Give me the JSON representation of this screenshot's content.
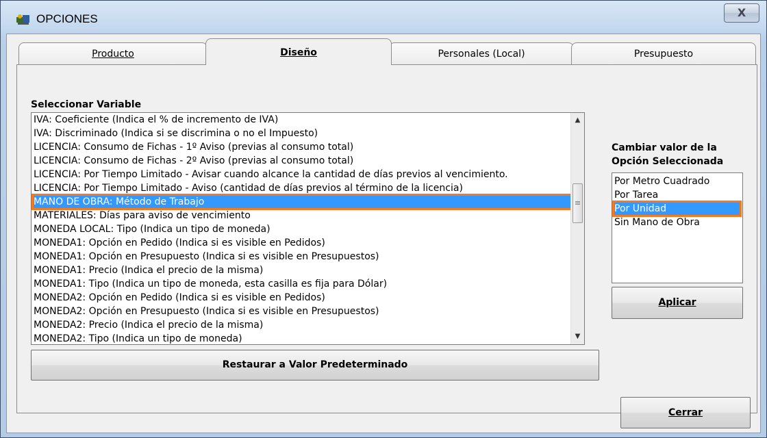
{
  "window": {
    "title": "OPCIONES",
    "close_label": "X"
  },
  "tabs": [
    {
      "label": "Producto",
      "active": false
    },
    {
      "label": "Diseño",
      "active": true
    },
    {
      "label": "Personales (Local)",
      "active": false
    },
    {
      "label": "Presupuesto",
      "active": false
    }
  ],
  "variables": {
    "heading": "Seleccionar Variable",
    "items": [
      "IVA: Coeficiente (Indica el % de incremento de IVA)",
      "IVA: Discriminado (Indica si se discrimina o no el Impuesto)",
      "LICENCIA: Consumo de Fichas - 1º Aviso (previas al consumo total)",
      "LICENCIA: Consumo de Fichas - 2º Aviso (previas al consumo total)",
      "LICENCIA: Por Tiempo Limitado - Avisar cuando alcance la cantidad de días previos al vencimiento.",
      "LICENCIA: Por Tiempo Limitado - Aviso (cantidad de días previos al término de la licencia)",
      "MANO DE OBRA: Método de Trabajo",
      "MATERIALES: Días para aviso de vencimiento",
      "MONEDA LOCAL: Tipo (Indica un tipo de moneda)",
      "MONEDA1: Opción en Pedido (Indica si es visible en Pedidos)",
      "MONEDA1: Opción en Presupuesto (Indica si es visible en Presupuestos)",
      "MONEDA1: Precio (Indica el precio de la misma)",
      "MONEDA1: Tipo (Indica un tipo de moneda, esta casilla es fija para Dólar)",
      "MONEDA2: Opción en Pedido (Indica si es visible en Pedidos)",
      "MONEDA2: Opción en Presupuesto (Indica si es visible en Presupuestos)",
      "MONEDA2: Precio (Indica el precio de la misma)",
      "MONEDA2: Tipo (Indica un tipo de moneda)"
    ],
    "selected_index": 6,
    "restore_button": "Restaurar a Valor Predeterminado"
  },
  "values": {
    "heading_line1": "Cambiar valor de la",
    "heading_line2": "Opción Seleccionada",
    "items": [
      "Por Metro Cuadrado",
      "Por Tarea",
      "Por Unidad",
      "Sin Mano de Obra"
    ],
    "selected_index": 2,
    "apply_button": "Aplicar"
  },
  "footer": {
    "close_button": "Cerrar"
  },
  "colors": {
    "selection": "#3399ff",
    "highlight_outline": "#f47920"
  }
}
